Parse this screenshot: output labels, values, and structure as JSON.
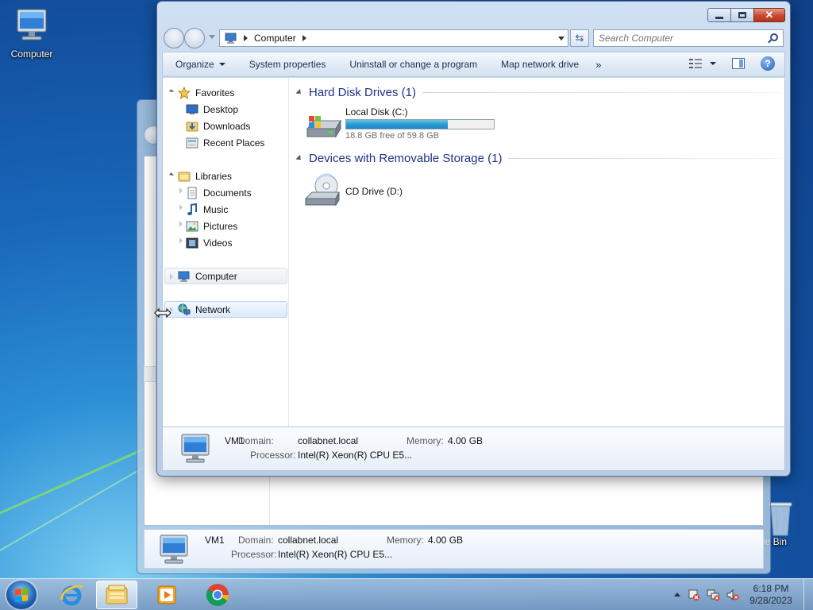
{
  "desktop": {
    "computer_label": "Computer",
    "recycle_bin_label": "cle Bin"
  },
  "window": {
    "address_crumb": "Computer",
    "search_placeholder": "Search Computer",
    "toolbar": {
      "organize": "Organize",
      "system_properties": "System properties",
      "uninstall": "Uninstall or change a program",
      "map_drive": "Map network drive",
      "more": "»"
    },
    "nav": {
      "favorites": "Favorites",
      "desktop": "Desktop",
      "downloads": "Downloads",
      "recent_places": "Recent Places",
      "libraries": "Libraries",
      "documents": "Documents",
      "music": "Music",
      "pictures": "Pictures",
      "videos": "Videos",
      "computer": "Computer",
      "network": "Network"
    },
    "groups": {
      "hdd_header": "Hard Disk Drives (1)",
      "removable_header": "Devices with Removable Storage (1)"
    },
    "drives": {
      "c_name": "Local Disk (C:)",
      "c_free": "18.8 GB free of 59.8 GB",
      "c_used_fraction": 0.686,
      "d_name": "CD Drive (D:)"
    },
    "details": {
      "name": "VM1",
      "domain_label": "Domain:",
      "domain_value": "collabnet.local",
      "memory_label": "Memory:",
      "memory_value": "4.00 GB",
      "processor_label": "Processor:",
      "processor_value": "Intel(R) Xeon(R) CPU E5..."
    }
  },
  "back_window": {
    "details": {
      "name": "VM1",
      "domain_label": "Domain:",
      "domain_value": "collabnet.local",
      "memory_label": "Memory:",
      "memory_value": "4.00 GB",
      "processor_label": "Processor:",
      "processor_value": "Intel(R) Xeon(R) CPU E5..."
    }
  },
  "taskbar": {
    "time": "6:18 PM",
    "date": "9/28/2023"
  },
  "icons": [
    "computer-icon",
    "recycle-bin-icon",
    "star-icon",
    "folder-icon",
    "drive-icon",
    "cd-drive-icon",
    "internet-explorer-icon",
    "explorer-icon",
    "media-player-icon",
    "chrome-icon",
    "network-icon"
  ]
}
